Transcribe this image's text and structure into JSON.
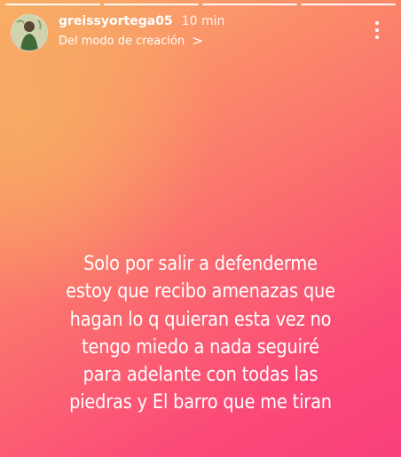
{
  "story": {
    "username": "greissyortega05",
    "time": "10 min",
    "subtitle": "Del modo de creación",
    "subtitle_chevron": ">",
    "more_icon": "more-vertical-icon",
    "progress_segments": 4,
    "progress_completed": 4,
    "text_lines": [
      "Solo por salir a defenderme",
      "estoy que recibo amenazas que",
      "hagan lo q quieran esta vez no",
      "tengo miedo a nada seguiré",
      "para adelante con todas las",
      "piedras y El barro que me tiran"
    ]
  },
  "colors": {
    "gradient_top": "#f8b167",
    "gradient_bottom": "#f8407a",
    "text": "#ffffff"
  }
}
